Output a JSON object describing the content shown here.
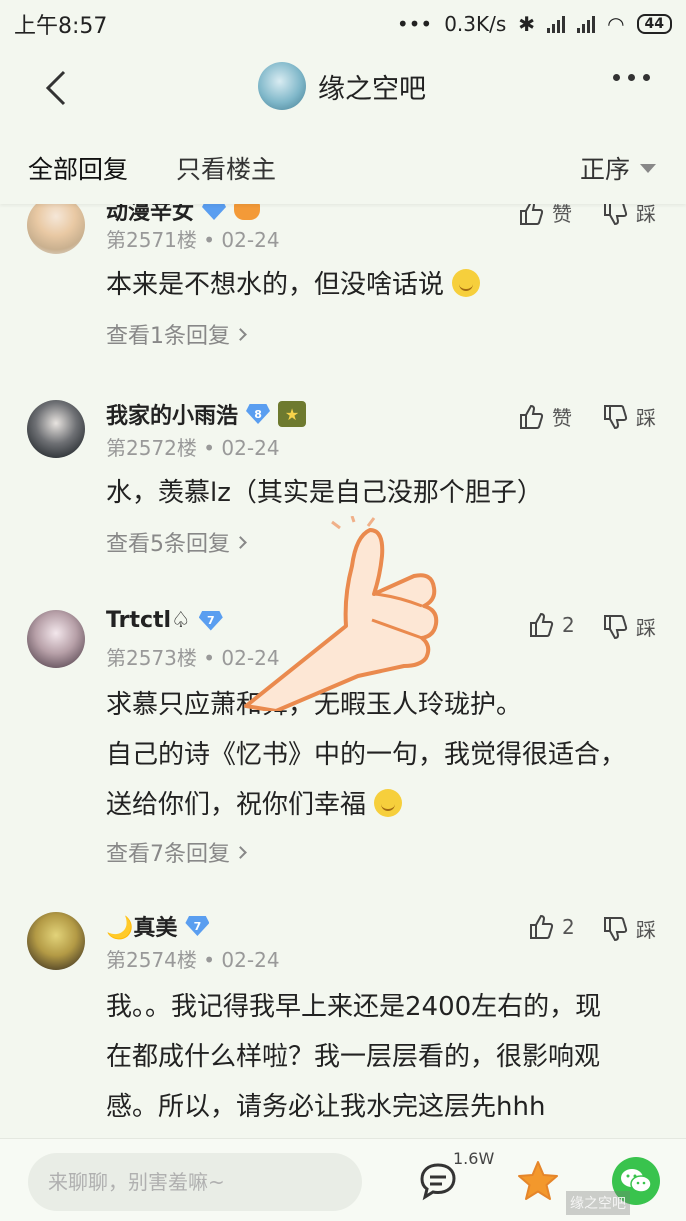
{
  "status_bar": {
    "time": "上午8:57",
    "network_speed": "0.3K/s",
    "battery": "44"
  },
  "nav": {
    "forum_title": "缘之空吧"
  },
  "tabs": {
    "all": "全部回复",
    "owner_only": "只看楼主",
    "sort": "正序"
  },
  "actions": {
    "like": "赞",
    "dislike": "踩"
  },
  "posts": [
    {
      "username": "动漫辛女",
      "floor": "第2571楼",
      "date": "02-24",
      "text": "本来是不想水的，但没啥话说",
      "replies": "查看1条回复",
      "like_label": "赞"
    },
    {
      "username": "我家的小雨浩",
      "level": "8",
      "floor": "第2572楼",
      "date": "02-24",
      "text": "水，羡慕lz（其实是自己没那个胆子）",
      "replies": "查看5条回复",
      "like_label": "赞"
    },
    {
      "username": "Trtctl♤",
      "level": "7",
      "floor": "第2573楼",
      "date": "02-24",
      "text_line1": "求慕只应萧和舞，无暇玉人玲珑护。",
      "text_line2": "自己的诗《忆书》中的一句，我觉得很适合，送给你们，祝你们幸福",
      "replies": "查看7条回复",
      "like_label": "2"
    },
    {
      "username": "🌙真美",
      "level": "7",
      "floor": "第2574楼",
      "date": "02-24",
      "text": "我。。我记得我早上来还是2400左右的，现在都成什么样啦？我一层层看的，很影响观感。所以，请务必让我水完这层先hhh",
      "like_label": "2"
    }
  ],
  "bottom_bar": {
    "input_placeholder": "来聊聊，别害羞嘛~",
    "comment_count": "1.6W",
    "watermark": "缘之空吧"
  },
  "icons": {
    "back": "chevron-left-icon",
    "more": "more-dots-icon",
    "like": "thumb-up-icon",
    "dislike": "thumb-down-icon",
    "comment": "comment-bubble-icon",
    "star": "star-icon",
    "wechat": "wechat-icon"
  },
  "colors": {
    "background": "#f3f7ef",
    "level_badge": "#5a9ef0",
    "star": "#f3982c",
    "wechat": "#39c34d"
  }
}
